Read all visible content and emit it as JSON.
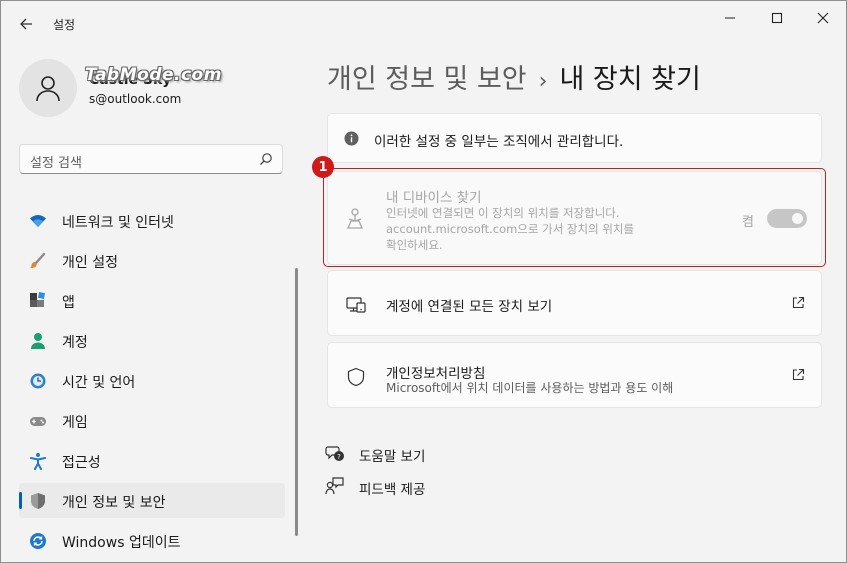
{
  "app": {
    "title": "설정"
  },
  "account": {
    "name": "Castle Sky",
    "email": "s@outlook.com"
  },
  "watermark": "TabMode.com",
  "search": {
    "placeholder": "설정 검색"
  },
  "sidebar": {
    "items": [
      {
        "label": "네트워크 및 인터넷",
        "icon": "wifi-icon"
      },
      {
        "label": "개인 설정",
        "icon": "brush-icon"
      },
      {
        "label": "앱",
        "icon": "apps-icon"
      },
      {
        "label": "계정",
        "icon": "person-icon"
      },
      {
        "label": "시간 및 언어",
        "icon": "clock-globe-icon"
      },
      {
        "label": "게임",
        "icon": "gamepad-icon"
      },
      {
        "label": "접근성",
        "icon": "accessibility-icon"
      },
      {
        "label": "개인 정보 및 보안",
        "icon": "shield-icon",
        "active": true
      },
      {
        "label": "Windows 업데이트",
        "icon": "update-icon"
      }
    ]
  },
  "header": {
    "parent": "개인 정보 및 보안",
    "separator": "›",
    "current": "내 장치 찾기"
  },
  "info_banner": {
    "text": "이러한 설정 중 일부는 조직에서 관리합니다."
  },
  "annotation": {
    "badge": "1"
  },
  "find_device": {
    "title": "내 디바이스 찾기",
    "description": "인터넷에 연결되면 이 장치의 위치를 저장합니다. account.microsoft.com으로 가서 장치의 위치를 확인하세요.",
    "toggle_label": "켬",
    "toggle_on": true
  },
  "links": [
    {
      "title": "계정에 연결된 모든 장치 보기",
      "subtitle": ""
    },
    {
      "title": "개인정보처리방침",
      "subtitle": "Microsoft에서 위치 데이터를 사용하는 방법과 용도 이해"
    }
  ],
  "help": {
    "help_label": "도움말 보기",
    "feedback_label": "피드백 제공"
  },
  "colors": {
    "accent": "#005fb8",
    "annotation_red": "#d0191a",
    "window_bg": "#f3f3f3"
  }
}
